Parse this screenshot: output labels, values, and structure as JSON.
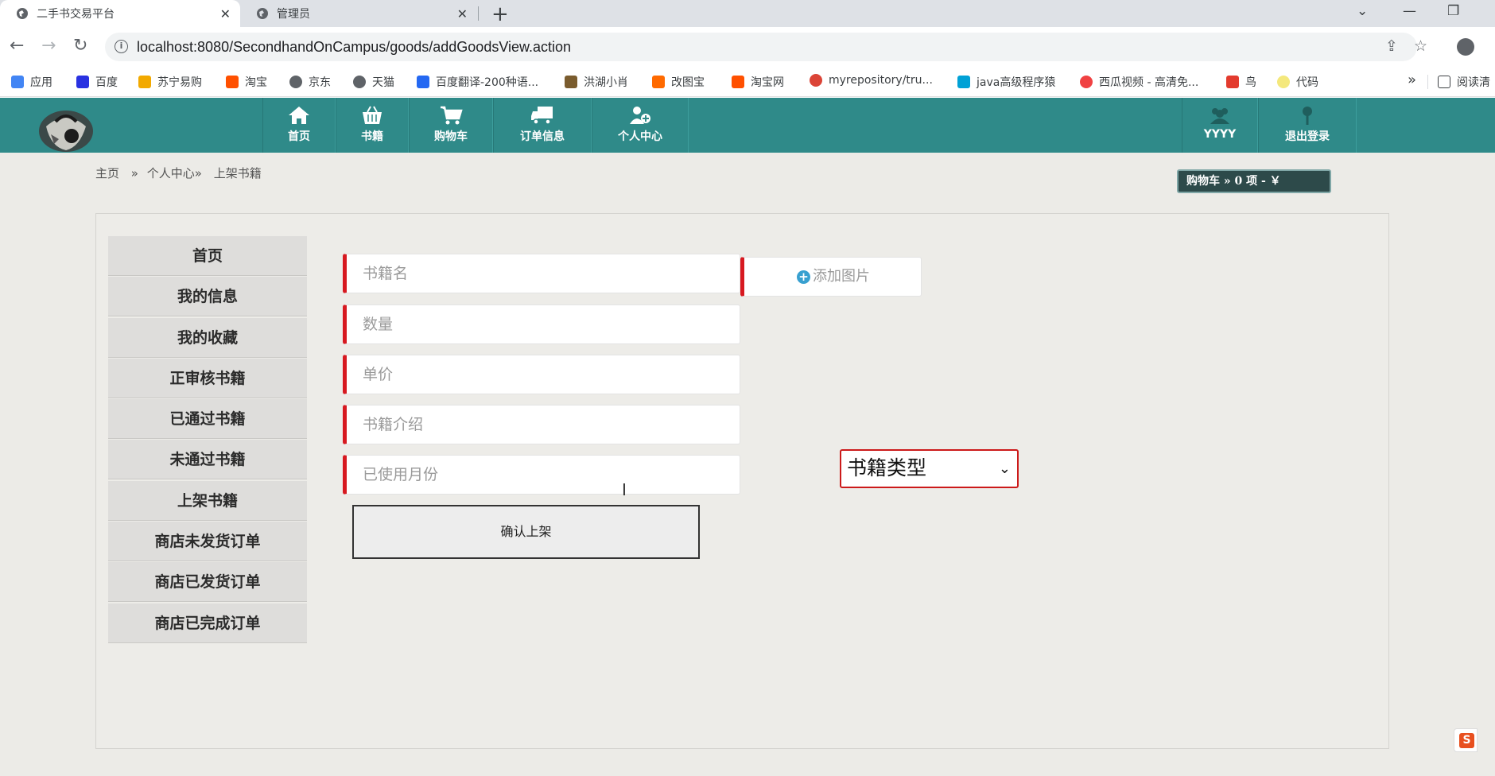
{
  "browser": {
    "tabs": [
      {
        "title": "二手书交易平台",
        "active": true
      },
      {
        "title": "管理员",
        "active": false
      }
    ],
    "url": "localhost:8080/SecondhandOnCampus/goods/addGoodsView.action",
    "bookmarks": [
      {
        "label": "应用",
        "color": "#4285f4"
      },
      {
        "label": "百度",
        "color": "#2932e1"
      },
      {
        "label": "苏宁易购",
        "color": "#f2a900"
      },
      {
        "label": "淘宝",
        "color": "#ff5000"
      },
      {
        "label": "京东",
        "color": "#5f6368"
      },
      {
        "label": "天猫",
        "color": "#5f6368"
      },
      {
        "label": "百度翻译-200种语...",
        "color": "#2468f2"
      },
      {
        "label": "洪湖小肖",
        "color": "#7a5c2e"
      },
      {
        "label": "改图宝",
        "color": "#ff6a00"
      },
      {
        "label": "淘宝网",
        "color": "#ff5000"
      },
      {
        "label": "myrepository/tru...",
        "color": "#db4437"
      },
      {
        "label": "java高级程序猿",
        "color": "#00a1d6"
      },
      {
        "label": "西瓜视频 - 高清免...",
        "color": "#f04142"
      },
      {
        "label": "鸟",
        "color": "#e33b2e"
      },
      {
        "label": "代码",
        "color": "#f4e87c"
      }
    ],
    "reading_list": "阅读清"
  },
  "header": {
    "nav": [
      {
        "label": "首页",
        "icon": "home-icon"
      },
      {
        "label": "书籍",
        "icon": "basket-icon"
      },
      {
        "label": "购物车",
        "icon": "cart-icon"
      },
      {
        "label": "订单信息",
        "icon": "truck-icon"
      },
      {
        "label": "个人中心",
        "icon": "user-add-icon"
      }
    ],
    "user": {
      "label": "YYYY",
      "icon": "users-icon"
    },
    "logout": {
      "label": "退出登录",
      "icon": "pin-icon"
    }
  },
  "breadcrumb": {
    "home": "主页",
    "sep1": "»",
    "center": "个人中心»",
    "current": "上架书籍"
  },
  "cart_widget": "购物车  » 0 项 - ￥",
  "side_menu": [
    "首页",
    "我的信息",
    "我的收藏",
    "正审核书籍",
    "已通过书籍",
    "未通过书籍",
    "上架书籍",
    "商店未发货订单",
    "商店已发货订单",
    "商店已完成订单"
  ],
  "form": {
    "book_name_placeholder": "书籍名",
    "quantity_placeholder": "数量",
    "price_placeholder": "单价",
    "intro_placeholder": "书籍介绍",
    "months_placeholder": "已使用月份",
    "add_image": "添加图片",
    "type_select": "书籍类型",
    "submit": "确认上架"
  }
}
